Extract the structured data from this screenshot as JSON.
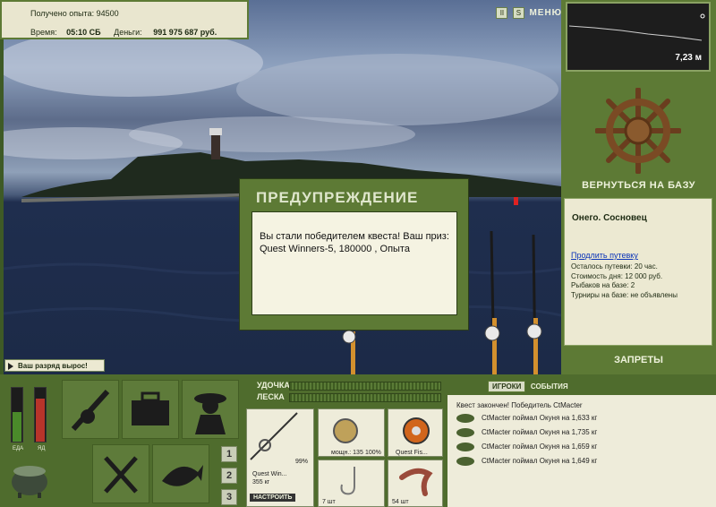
{
  "info": {
    "xp_label": "Получено опыта:",
    "xp_value": "94500",
    "time_label": "Время:",
    "time_value": "05:10 СБ",
    "money_label": "Деньги:",
    "money_value": "991 975 687 руб."
  },
  "topbar": {
    "pause_icon": "pause-icon",
    "sound_icon": "sound-icon",
    "menu_label": "МЕНЮ"
  },
  "depth": {
    "value": "7,23 м"
  },
  "base": {
    "return_label": "ВЕРНУТЬСЯ НА БАЗУ",
    "name": "Онего. Сосновец",
    "extend_link": "Продлить путевку",
    "lines": [
      "Осталось путевки: 20 час.",
      "Стоимость дня: 12 000 руб.",
      "Рыбаков на базе: 2",
      "Турниры на базе: не объявлены"
    ],
    "bans_label": "ЗАПРЕТЫ"
  },
  "toast": {
    "rank_up": "Ваш разряд вырос!"
  },
  "dialog": {
    "title": "ПРЕДУПРЕЖДЕНИЕ",
    "message": "Вы стали победителем квеста! Ваш приз: Quest Winners-5, 180000 , Опыта"
  },
  "gauges": {
    "food_label": "ЕДА",
    "poison_label": "ЯД",
    "food_level": 0.55,
    "poison_level": 0.8
  },
  "bottom": {
    "rod_label": "УДОЧКА",
    "line_label": "ЛЕСКА",
    "rod_name": "Quest Win...",
    "rod_weight": "355 кг",
    "rod_percent": "99%",
    "setup_button": "НАСТРОИТЬ",
    "reel_info": "мощн.: 135",
    "reel_percent": "100%",
    "line_name": "Quest Fis...",
    "hook_count": "7 шт",
    "bait_count": "54 шт",
    "rod_slots": [
      "1",
      "2",
      "3"
    ]
  },
  "chat": {
    "tab_players": "ИГРОКИ",
    "tab_events": "СОБЫТИЯ",
    "header": "Квест закончен! Победитель CtMacter",
    "events": [
      "CtMacter поймал Окуня на 1,633 кг",
      "CtMacter поймал Окуня на 1,735 кг",
      "CtMacter поймал Окуня на 1,659 кг",
      "CtMacter поймал Окуня на 1,649 кг"
    ]
  },
  "colors": {
    "panel_green": "#5d7a35",
    "dark_green": "#4f6c2d",
    "cream": "#ece9d2"
  }
}
